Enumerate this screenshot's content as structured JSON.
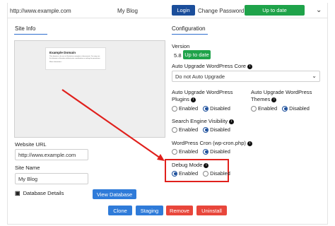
{
  "topbar": {
    "url": "http://www.example.com",
    "blog": "My Blog",
    "login": "Login",
    "change_password": "Change Password",
    "status": "Up to date",
    "chevron": "chevron-down-icon"
  },
  "site_info": {
    "title": "Site Info",
    "preview_title": "Example Domain",
    "preview_text": "This domain is for use in illustrative examples in documents. You may use this domain in literature without prior coordination or asking for permission.",
    "preview_link": "More information...",
    "website_url_label": "Website URL",
    "website_url_value": "http://www.example.com",
    "site_name_label": "Site Name",
    "site_name_value": "My Blog",
    "db_details": "Database Details",
    "view_db": "View Database"
  },
  "configuration": {
    "title": "Configuration",
    "version_label": "Version",
    "version_value": "5.8",
    "version_status": "Up to date",
    "auto_core_label": "Auto Upgrade WordPress Core",
    "auto_core_value": "Do not Auto Upgrade",
    "plugins_label_1": "Auto Upgrade WordPress",
    "plugins_label_2": "Plugins",
    "themes_label_1": "Auto Upgrade WordPress",
    "themes_label_2": "Themes",
    "enabled": "Enabled",
    "disabled": "Disabled",
    "search_label": "Search Engine Visibility",
    "cron_label": "WordPress Cron (wp-cron.php)",
    "debug_label": "Debug Mode"
  },
  "actions": {
    "clone": "Clone",
    "staging": "Staging",
    "remove": "Remove",
    "uninstall": "Uninstall"
  },
  "colors": {
    "dark_blue": "#1b4e9b",
    "green": "#1fa34a",
    "blue": "#2f7bd9",
    "red": "#e8463b",
    "annotation_red": "#e0201c"
  }
}
